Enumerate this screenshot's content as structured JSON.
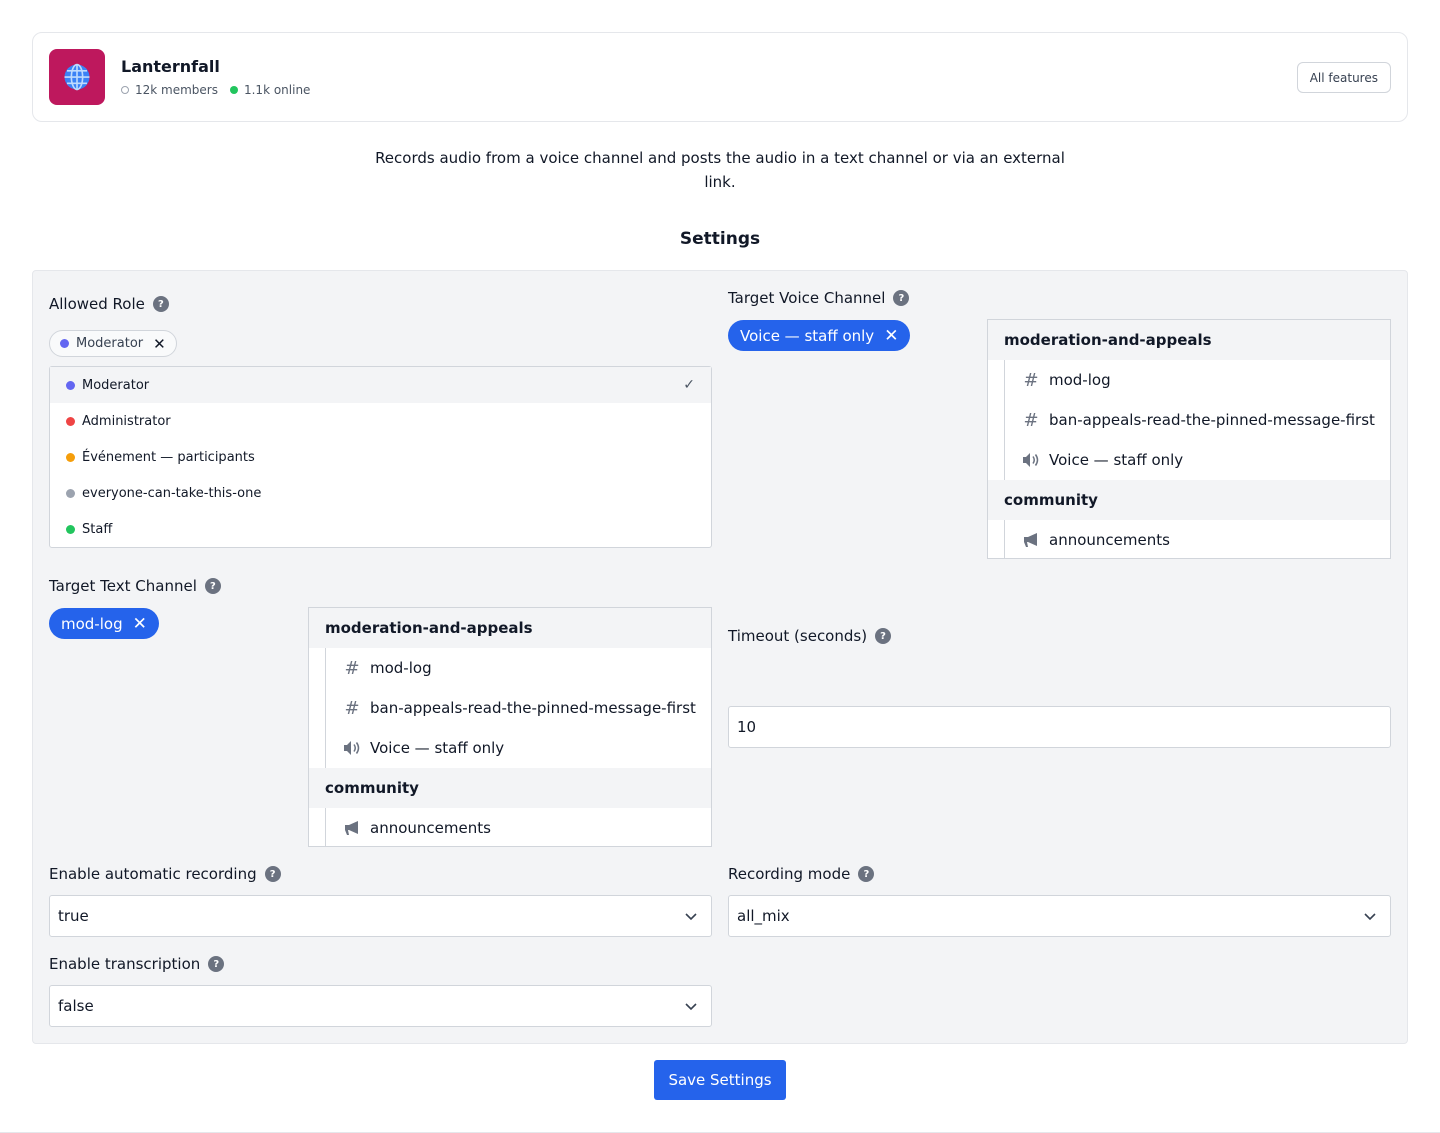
{
  "server": {
    "icon": "globe-icon",
    "name": "Lanternfall",
    "members": "12k members",
    "online": "1.1k online",
    "features_label": "All features"
  },
  "description": "Records audio from a voice channel and posts the audio in a text channel or via an external link.",
  "settings_title": "Settings",
  "allowed_role": {
    "label": "Allowed Role",
    "selected": {
      "name": "Moderator",
      "color": "#6366f1"
    },
    "options": [
      {
        "name": "Moderator",
        "color": "#6366f1",
        "selected": true
      },
      {
        "name": "Administrator",
        "color": "#ef4444",
        "selected": false
      },
      {
        "name": "Événement — participants",
        "color": "#f59e0b",
        "selected": false
      },
      {
        "name": "everyone-can-take-this-one",
        "color": "#9ca3af",
        "selected": false
      },
      {
        "name": "Staff",
        "color": "#22c55e",
        "selected": false
      }
    ]
  },
  "target_voice": {
    "label": "Target Voice Channel",
    "selected": "Voice — staff only",
    "categories": [
      {
        "name": "moderation-and-appeals",
        "channels": [
          {
            "name": "mod-log",
            "icon": "hash-icon"
          },
          {
            "name": "ban-appeals-read-the-pinned-message-first",
            "icon": "hash-icon"
          },
          {
            "name": "Voice — staff only",
            "icon": "speaker-icon"
          }
        ]
      },
      {
        "name": "community",
        "channels": [
          {
            "name": "announcements",
            "icon": "megaphone-icon"
          }
        ]
      }
    ]
  },
  "target_text": {
    "label": "Target Text Channel",
    "selected": "mod-log",
    "categories": [
      {
        "name": "moderation-and-appeals",
        "channels": [
          {
            "name": "mod-log",
            "icon": "hash-icon"
          },
          {
            "name": "ban-appeals-read-the-pinned-message-first",
            "icon": "hash-icon"
          },
          {
            "name": "Voice — staff only",
            "icon": "speaker-icon"
          }
        ]
      },
      {
        "name": "community",
        "channels": [
          {
            "name": "announcements",
            "icon": "megaphone-icon"
          }
        ]
      }
    ]
  },
  "timeout": {
    "label": "Timeout (seconds)",
    "value": "10"
  },
  "auto_record": {
    "label": "Enable automatic recording",
    "value": "true"
  },
  "recording_mode": {
    "label": "Recording mode",
    "value": "all_mix"
  },
  "transcription": {
    "label": "Enable transcription",
    "value": "false"
  },
  "save_label": "Save Settings",
  "colors": {
    "accent": "#2563eb",
    "server_icon_bg": "#be185d",
    "panel_bg": "#f3f4f6"
  }
}
